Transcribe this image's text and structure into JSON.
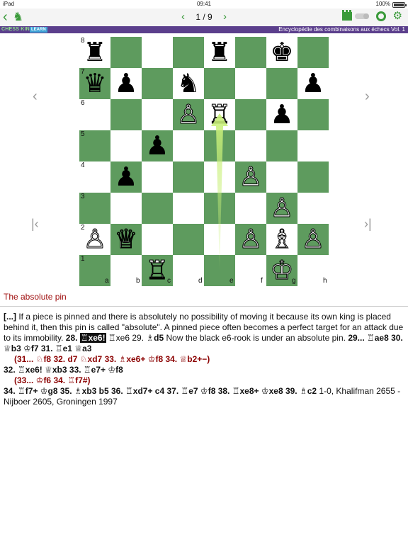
{
  "status_bar": {
    "device": "iPad",
    "time": "09:41",
    "battery": "100%"
  },
  "toolbar": {
    "back_glyph": "‹",
    "logo_glyph": "♞",
    "prev_glyph": "‹",
    "next_glyph": "›",
    "page_counter": "1 / 9",
    "gear_glyph": "⚙",
    "accent_color": "#3a9a3a"
  },
  "banner": {
    "brand_name": "CHESS KING",
    "brand_tag": "LEARN",
    "course_title": "Encyclopédie des combinaisons aux échecs Vol. 1",
    "background_color": "#5b3f8c"
  },
  "board": {
    "light_color": "#ffffff",
    "dark_color": "#5e9b5e",
    "ranks": [
      "8",
      "7",
      "6",
      "5",
      "4",
      "3",
      "2",
      "1"
    ],
    "files": [
      "a",
      "b",
      "c",
      "d",
      "e",
      "f",
      "g",
      "h"
    ],
    "pieces": [
      {
        "square": "a8",
        "glyph": "♜",
        "color": "black"
      },
      {
        "square": "e8",
        "glyph": "♜",
        "color": "black"
      },
      {
        "square": "g8",
        "glyph": "♚",
        "color": "black"
      },
      {
        "square": "a7",
        "glyph": "♛",
        "color": "black"
      },
      {
        "square": "b7",
        "glyph": "♟",
        "color": "black"
      },
      {
        "square": "d7",
        "glyph": "♞",
        "color": "black"
      },
      {
        "square": "h7",
        "glyph": "♟",
        "color": "black"
      },
      {
        "square": "d6",
        "glyph": "♙",
        "color": "white"
      },
      {
        "square": "e6",
        "glyph": "♖",
        "color": "white"
      },
      {
        "square": "g6",
        "glyph": "♟",
        "color": "black"
      },
      {
        "square": "c5",
        "glyph": "♟",
        "color": "black"
      },
      {
        "square": "b4",
        "glyph": "♟",
        "color": "black"
      },
      {
        "square": "f4",
        "glyph": "♙",
        "color": "white"
      },
      {
        "square": "g3",
        "glyph": "♙",
        "color": "white"
      },
      {
        "square": "a2",
        "glyph": "♙",
        "color": "white"
      },
      {
        "square": "b2",
        "glyph": "♕",
        "color": "white"
      },
      {
        "square": "f2",
        "glyph": "♙",
        "color": "white"
      },
      {
        "square": "g2",
        "glyph": "♗",
        "color": "white"
      },
      {
        "square": "h2",
        "glyph": "♙",
        "color": "white"
      },
      {
        "square": "c1",
        "glyph": "♖",
        "color": "white"
      },
      {
        "square": "g1",
        "glyph": "♔",
        "color": "white"
      }
    ],
    "arrow": {
      "from": "e1",
      "to": "e6",
      "color": "#c9f07a"
    }
  },
  "nav": {
    "prev_move": "‹",
    "next_move": "›",
    "first_move": "|‹",
    "last_move": "›|"
  },
  "content": {
    "theme": "The absolute pin",
    "intro_marker": "[...]",
    "intro_text": " If a piece is pinned and there is absolutely no possibility of moving it because its own king is placed behind it, then this pin is called \"absolute\". A pinned piece often becomes a perfect target for an attack due to its immobility. ",
    "m28": "28. ",
    "m28_white": "♖xe6!",
    "m28_black": " ♖xe6 29. ",
    "m29_white": "♗d5",
    "m29_note": " Now the black e6-rook is under an absolute pin. ",
    "m29_black": "29... ♖ae8 30. ♕b3 ♔f7 31. ♖e1 ♕a3",
    "var1": "(31... ♘f8 32. d7 ♘xd7 33. ♗xe6+ ♔f8 34. ♕b2+−)",
    "line32": "32. ♖xe6! ♕xb3 33. ♖e7+ ♔f8",
    "var2": "(33... ♔f6 34. ♖f7#)",
    "line34_moves": "34. ♖f7+ ♔g8 35. ♗xb3 b5 36. ♖xd7+ c4 37. ♖e7 ♔f8 38. ♖xe8+ ♔xe8 39. ♗c2",
    "line34_result": " 1-0, Khalifman 2655 - Nijboer 2605, Groningen 1997"
  }
}
